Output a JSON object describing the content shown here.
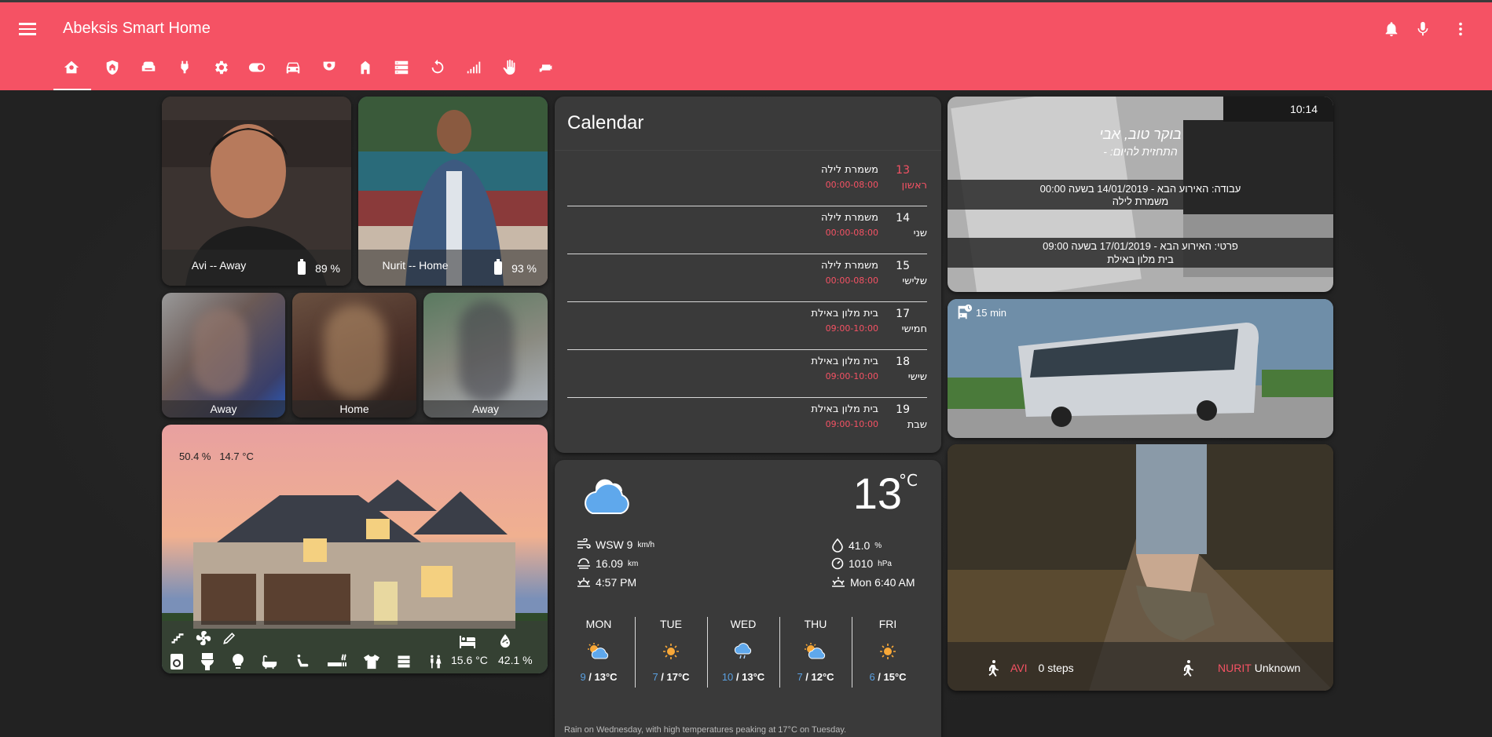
{
  "header": {
    "title": "Abeksis Smart Home",
    "background": "#f55264",
    "icons": [
      "bell-icon",
      "microphone-icon",
      "more-vert-icon"
    ],
    "tabs": [
      "home-automation",
      "shield-home",
      "sofa",
      "power-plug",
      "settings",
      "toggle-switch",
      "car",
      "cctv",
      "home-modern",
      "server",
      "restart",
      "signal",
      "hand",
      "cctv-2"
    ]
  },
  "people": [
    {
      "name": "Avi -- Away",
      "battery": "89 %"
    },
    {
      "name": "Nurit -- Home",
      "battery": "93 %"
    }
  ],
  "small_people": [
    "Away",
    "Home",
    "Away"
  ],
  "house": {
    "humidity": "50.4 %",
    "temperature": "14.7 °C",
    "bed_temp": "15.6 °C",
    "bed_humidity": "42.1 %"
  },
  "calendar": {
    "title": "Calendar",
    "accent": "#f55264",
    "rows": [
      {
        "day": "13",
        "event": "משמרת לילה",
        "time": "00:00-08:00",
        "weekday": "ראשון",
        "today": true
      },
      {
        "day": "14",
        "event": "משמרת לילה",
        "time": "00:00-08:00",
        "weekday": "שני",
        "today": false
      },
      {
        "day": "15",
        "event": "משמרת לילה",
        "time": "00:00-08:00",
        "weekday": "שלישי",
        "today": false
      },
      {
        "day": "17",
        "event": "בית מלון באילת",
        "time": "09:00-10:00",
        "weekday": "חמישי",
        "today": false
      },
      {
        "day": "18",
        "event": "בית מלון באילת",
        "time": "09:00-10:00",
        "weekday": "שישי",
        "today": false
      },
      {
        "day": "19",
        "event": "בית מלון באילת",
        "time": "09:00-10:00",
        "weekday": "שבת",
        "today": false
      }
    ]
  },
  "weather": {
    "temperature": "13",
    "unit": "°C",
    "wind": "WSW 9",
    "wind_unit": "km/h",
    "visibility": "16.09",
    "visibility_unit": "km",
    "sunset": "4:57 PM",
    "humidity": "41.0",
    "humidity_unit": "%",
    "pressure": "1010",
    "pressure_unit": "hPa",
    "sunrise": "Mon 6:40 AM",
    "forecast": [
      {
        "day": "MON",
        "low": "9",
        "high": "13°C",
        "icon": "partly-cloudy"
      },
      {
        "day": "TUE",
        "low": "7",
        "high": "17°C",
        "icon": "sunny"
      },
      {
        "day": "WED",
        "low": "10",
        "high": "13°C",
        "icon": "rain"
      },
      {
        "day": "THU",
        "low": "7",
        "high": "12°C",
        "icon": "partly-cloudy"
      },
      {
        "day": "FRI",
        "low": "6",
        "high": "15°C",
        "icon": "sunny"
      }
    ],
    "summary": "Rain on Wednesday, with high temperatures peaking at 17°C on Tuesday."
  },
  "greeting": {
    "time": "10:14",
    "title": "בוקר טוב, אבי",
    "subtitle": "התחזית להיום: -",
    "event1_line1": "עבודה: האירוע הבא - 14/01/2019 בשעה 00:00",
    "event1_line2": "משמרת לילה",
    "event2_line1": "פרטי: האירוע הבא - 17/01/2019 בשעה 09:00",
    "event2_line2": "בית מלון באילת"
  },
  "bus": {
    "eta": "15 min"
  },
  "steps": {
    "person1": "AVI",
    "value1": "0 steps",
    "person2": "NURIT",
    "value2": "Unknown"
  }
}
